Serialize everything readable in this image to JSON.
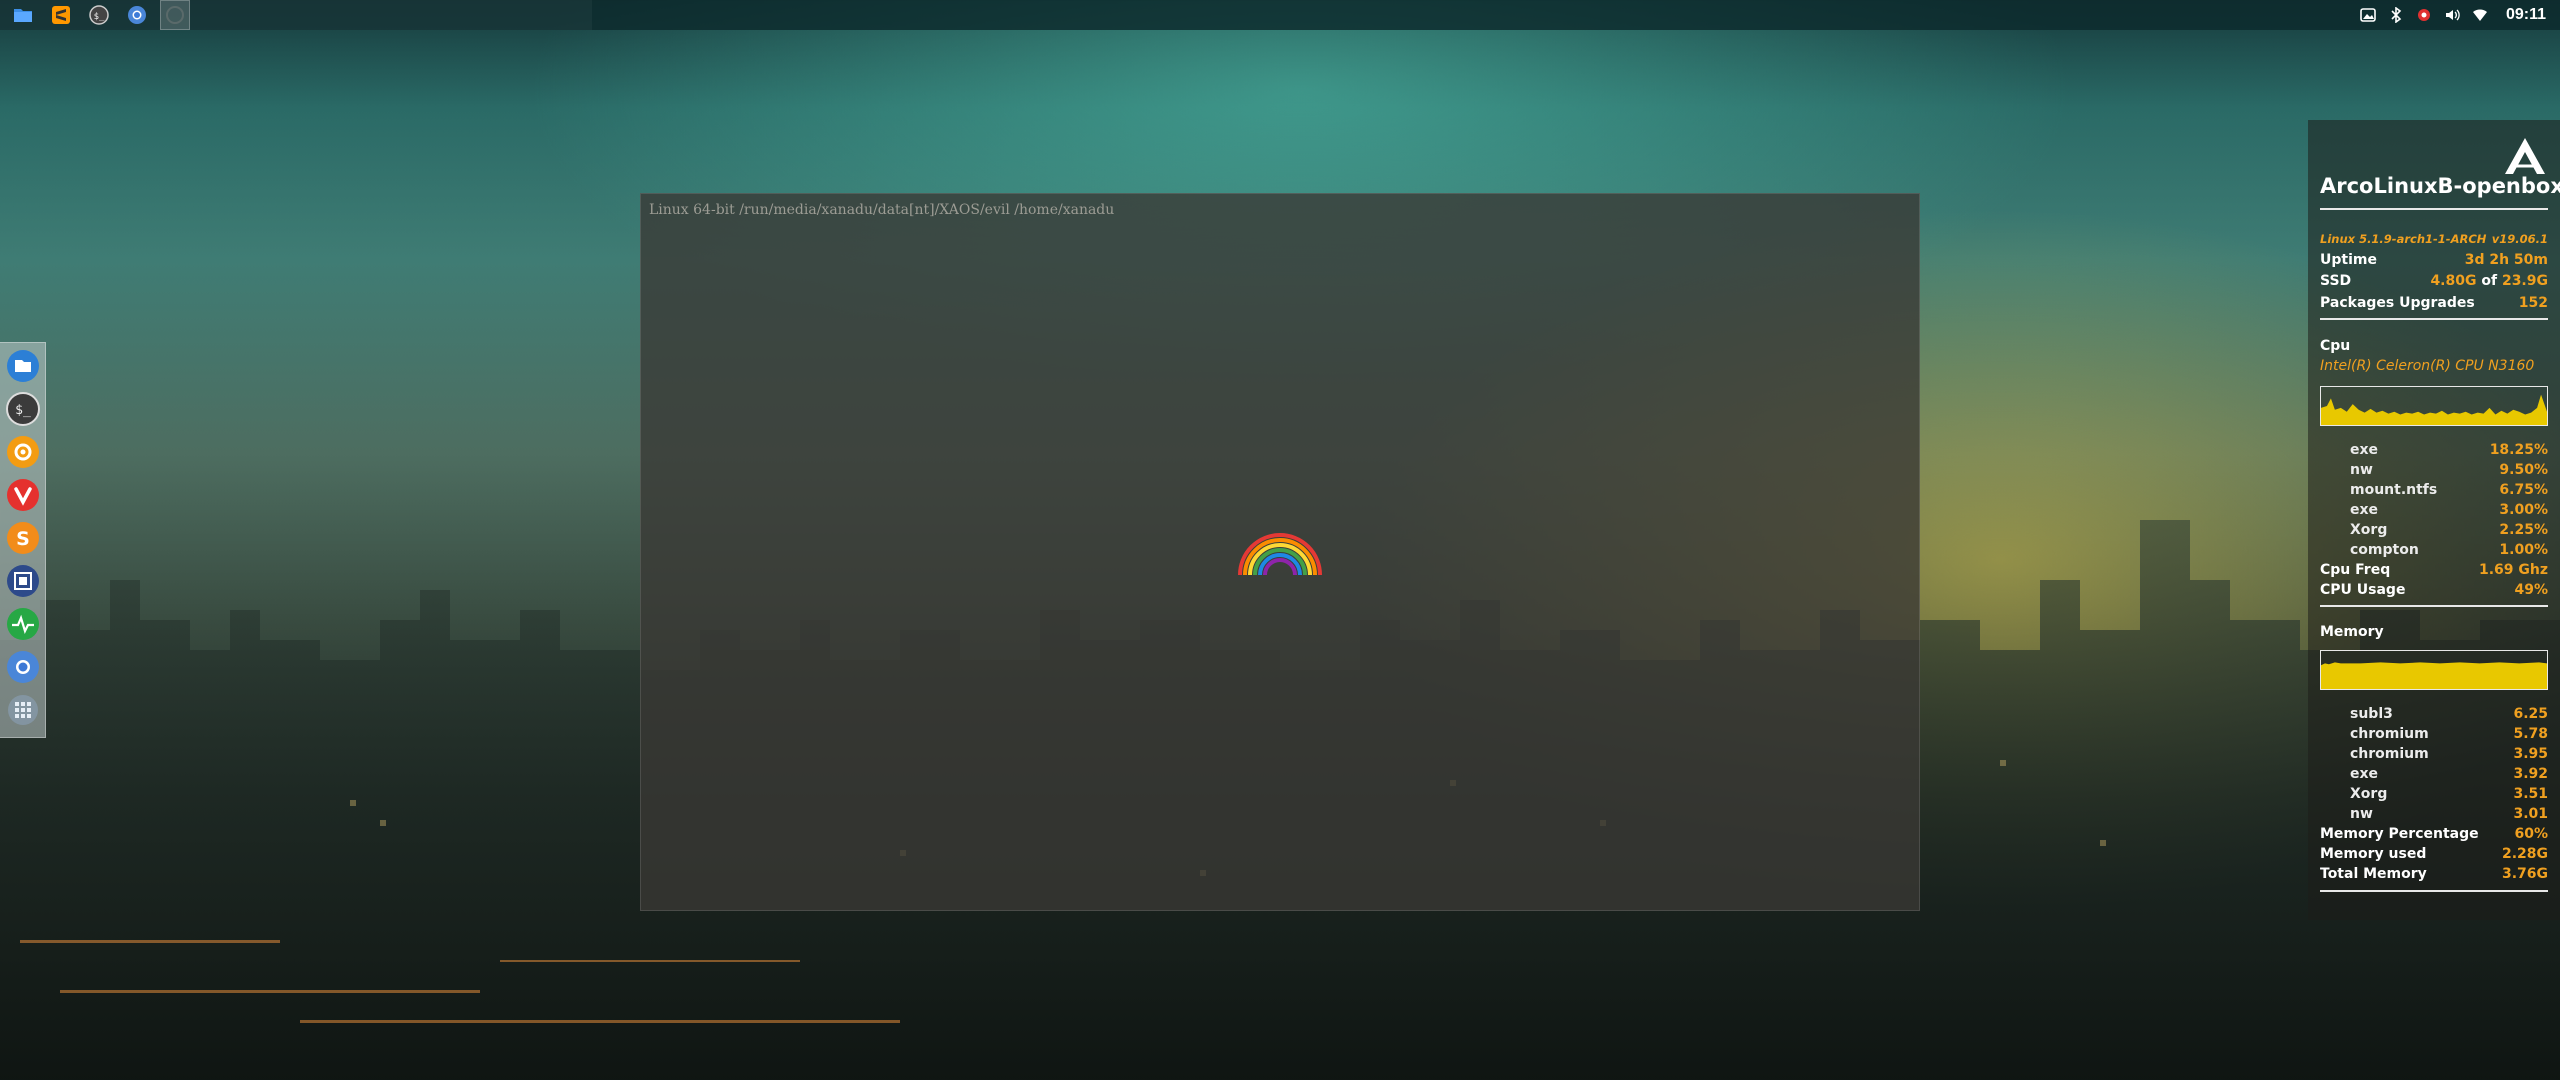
{
  "panel": {
    "launchers": [
      {
        "name": "file-manager-launcher",
        "icon": "folder-icon"
      },
      {
        "name": "sublime-text-launcher",
        "icon": "sublime-icon"
      },
      {
        "name": "terminal-launcher",
        "icon": "terminal-icon"
      },
      {
        "name": "chromium-launcher",
        "icon": "chromium-icon"
      },
      {
        "name": "active-window-button",
        "icon": "window-icon"
      }
    ],
    "tray_icons": [
      "screenshot-icon",
      "bluetooth-icon",
      "settings-icon",
      "volume-icon",
      "wifi-icon"
    ],
    "clock": "09:11"
  },
  "dock": {
    "items": [
      "files-icon",
      "terminal-icon",
      "settings-app-icon",
      "vivaldi-icon",
      "sublime-icon",
      "screenshot-app-icon",
      "system-monitor-icon",
      "chromium-icon",
      "app-grid-icon"
    ]
  },
  "terminal": {
    "title": "Linux 64-bit /run/media/xanadu/data[nt]/XAOS/evil /home/xanadu"
  },
  "conky": {
    "hostname": "ArcoLinuxB-openbox",
    "kernel": "Linux 5.1.9-arch1-1-ARCH",
    "version": "v19.06.1",
    "uptime_label": "Uptime",
    "uptime_value": "3d 2h 50m",
    "ssd_label": "SSD",
    "ssd_used": "4.80G",
    "ssd_of": " of ",
    "ssd_total": "23.9G",
    "packages_label": "Packages Upgrades",
    "packages_value": "152",
    "cpu_section": "Cpu",
    "cpu_name": "Intel(R) Celeron(R) CPU  N3160",
    "cpu_processes": [
      {
        "name": "exe",
        "value": "18.25%"
      },
      {
        "name": "nw",
        "value": "9.50%"
      },
      {
        "name": "mount.ntfs",
        "value": "6.75%"
      },
      {
        "name": "exe",
        "value": "3.00%"
      },
      {
        "name": "Xorg",
        "value": "2.25%"
      },
      {
        "name": "compton",
        "value": "1.00%"
      }
    ],
    "cpu_freq_label": "Cpu Freq",
    "cpu_freq_value": "1.69 Ghz",
    "cpu_usage_label": "CPU Usage",
    "cpu_usage_value": "49%",
    "memory_section": "Memory",
    "mem_processes": [
      {
        "name": "subl3",
        "value": "6.25"
      },
      {
        "name": "chromium",
        "value": "5.78"
      },
      {
        "name": "chromium",
        "value": "3.95"
      },
      {
        "name": "exe",
        "value": "3.92"
      },
      {
        "name": "Xorg",
        "value": "3.51"
      },
      {
        "name": "nw",
        "value": "3.01"
      }
    ],
    "mem_pct_label": "Memory Percentage",
    "mem_pct_value": "60%",
    "mem_used_label": "Memory used",
    "mem_used_value": "2.28G",
    "mem_total_label": "Total Memory",
    "mem_total_value": "3.76G"
  },
  "colors": {
    "accent": "#f0a020",
    "graph_fill": "#e8c800",
    "panel_bg": "#0c2a2c"
  }
}
